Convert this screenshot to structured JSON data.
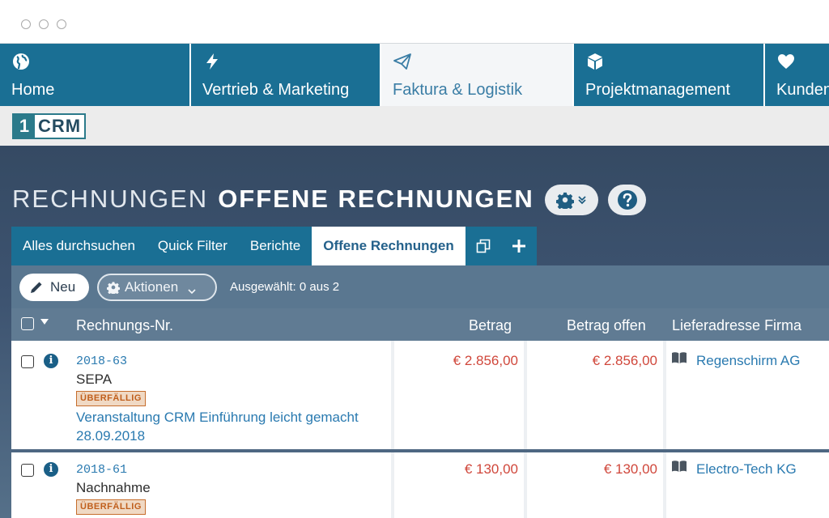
{
  "modules": [
    {
      "label": "Home",
      "icon": "globe-icon"
    },
    {
      "label": "Vertrieb & Marketing",
      "icon": "bolt-icon"
    },
    {
      "label": "Faktura & Logistik",
      "icon": "paper-plane-icon",
      "active": true
    },
    {
      "label": "Projektmanagement",
      "icon": "cube-icon"
    },
    {
      "label": "Kunden",
      "icon": "heart-icon"
    }
  ],
  "logo": {
    "one": "1",
    "crm": "CRM"
  },
  "page": {
    "title_module": "RECHNUNGEN",
    "title_view": "OFFENE RECHNUNGEN"
  },
  "subnav": {
    "tabs": [
      "Alles durchsuchen",
      "Quick Filter",
      "Berichte",
      "Offene Rechnungen"
    ],
    "active": "Offene Rechnungen"
  },
  "actions": {
    "new_label": "Neu",
    "actions_label": "Aktionen",
    "selected_text": "Ausgewählt: 0 aus 2"
  },
  "table": {
    "columns": [
      "Rechnungs-Nr.",
      "Betrag",
      "Betrag offen",
      "Lieferadresse Firma"
    ],
    "rows": [
      {
        "number": "2018-63",
        "payment": "SEPA",
        "badge": "ÜBERFÄLLIG",
        "subject": "Veranstaltung CRM Einführung leicht gemacht",
        "date": "28.09.2018",
        "amount": "€ 2.856,00",
        "amount_open": "€ 2.856,00",
        "company": "Regenschirm AG"
      },
      {
        "number": "2018-61",
        "payment": "Nachnahme",
        "badge": "ÜBERFÄLLIG",
        "amount": "€ 130,00",
        "amount_open": "€ 130,00",
        "company": "Electro-Tech KG"
      }
    ]
  },
  "colors": {
    "nav_blue": "#1a6f94",
    "link_blue": "#2a7ab0",
    "amount_red": "#d0473b",
    "badge_orange": "#c66e2d"
  }
}
